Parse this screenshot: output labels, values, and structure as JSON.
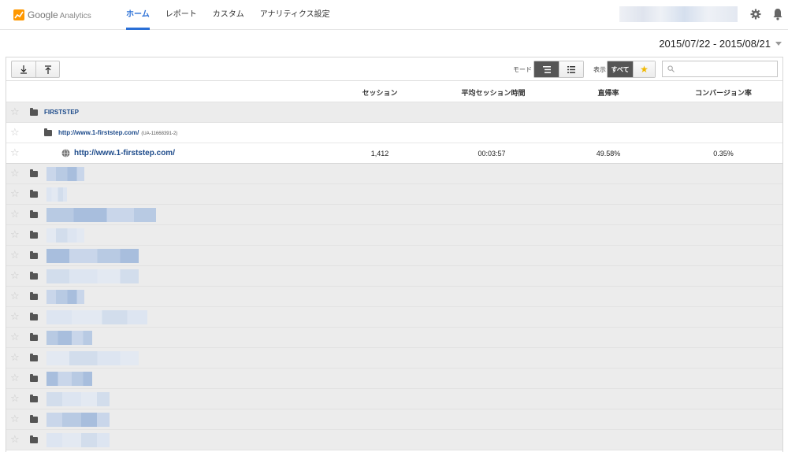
{
  "app": {
    "logo_text": "Google",
    "logo_sub": "Analytics",
    "brand_colors": {
      "orange": "#f57c00",
      "yellow": "#ffb300",
      "blue": "#2a6fd6"
    }
  },
  "nav": {
    "items": [
      {
        "label": "ホーム",
        "active": true
      },
      {
        "label": "レポート",
        "active": false
      },
      {
        "label": "カスタム",
        "active": false
      },
      {
        "label": "アナリティクス設定",
        "active": false
      }
    ]
  },
  "date_range": "2015/07/22 - 2015/08/21",
  "toolbar": {
    "mode_label": "モード",
    "show_label": "表示",
    "show_all": "すべて",
    "search_placeholder": ""
  },
  "columns": [
    "セッション",
    "平均セッション時間",
    "直帰率",
    "コンバージョン率"
  ],
  "account": {
    "name": "FIRSTSTEP"
  },
  "property": {
    "name": "http://www.1-firststep.com/",
    "id": "(UA-11668391-2)"
  },
  "view": {
    "name": "http://www.1-firststep.com/",
    "sessions": "1,412",
    "avg_session": "00:03:57",
    "bounce": "49.58%",
    "conversion": "0.35%"
  },
  "hidden_accounts": [
    {
      "blur": 0.28
    },
    {
      "blur": 0.15
    },
    {
      "blur": 0.82
    },
    {
      "blur": 0.28
    },
    {
      "blur": 0.69
    },
    {
      "blur": 0.69
    },
    {
      "blur": 0.28
    },
    {
      "blur": 0.75
    },
    {
      "blur": 0.34
    },
    {
      "blur": 0.69
    },
    {
      "blur": 0.34
    },
    {
      "blur": 0.47
    },
    {
      "blur": 0.47
    },
    {
      "blur": 0.47
    }
  ]
}
